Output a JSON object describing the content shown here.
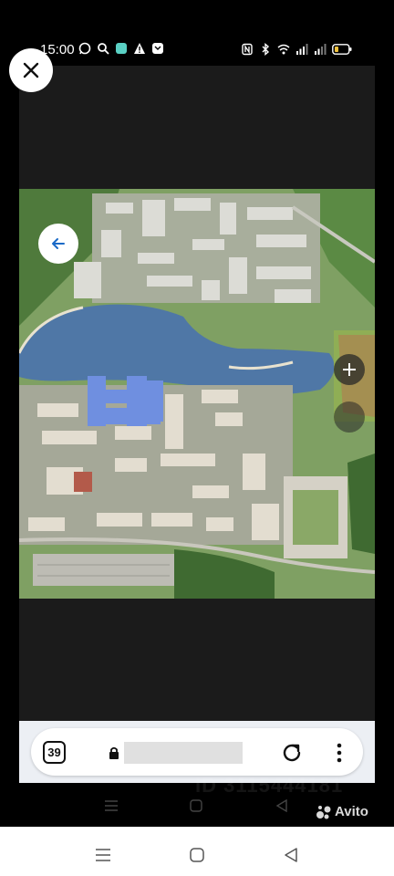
{
  "status_bar": {
    "time": "15:00",
    "left_icons": [
      "whatsapp-icon",
      "search-icon",
      "app-icon",
      "warning-icon",
      "message-icon"
    ],
    "right_icons": [
      "nfc-icon",
      "bluetooth-icon",
      "wifi-icon",
      "signal-icon",
      "signal-icon",
      "battery-icon"
    ]
  },
  "viewer": {
    "close_icon": "close-icon",
    "back_icon": "arrow-left-icon",
    "zoom_in_label": "+",
    "photo_description_icon": "residential-complex-render"
  },
  "browser": {
    "tabs_count": "39",
    "url": "",
    "reload_icon": "reload-icon",
    "menu_icon": "more-vertical-icon"
  },
  "watermark": {
    "id_text": "ID 3115444181",
    "brand": "Avito"
  },
  "colors": {
    "background": "#000000",
    "viewer_bg": "#1b1b1b",
    "water": "#4f77a6",
    "highlight_building": "#6f8fe0",
    "browser_bar": "#eceff4"
  }
}
